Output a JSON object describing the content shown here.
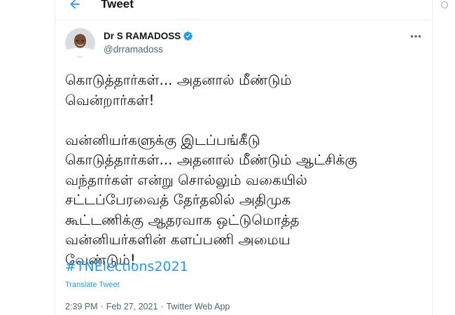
{
  "header": {
    "back_icon": "back-arrow-icon",
    "title": "Tweet",
    "accent_color": "#1d9bf0"
  },
  "tweet": {
    "author": {
      "name": "Dr S RAMADOSS",
      "handle": "@drramadoss",
      "verified": true,
      "verified_icon": "verified-badge-icon"
    },
    "more_icon": "more-horizontal-icon",
    "paragraphs": [
      [
        "கொடுத்தார்கள்... அதனால் மீண்டும்",
        "வென்றார்கள்!"
      ],
      [
        "வன்னியர்களுக்கு இடப்பங்கீடு",
        "கொடுத்தார்கள்... அதனால் மீண்டும் ஆட்சிக்கு",
        "வந்தார்கள் என்று சொல்லும் வகையில்",
        "சட்டப்பேரவைத் தேர்தலில் அதிமுக",
        "கூட்டணிக்கு ஆதரவாக ஒட்டுமொத்த",
        "வன்னியர்களின் களப்பணி அமைய",
        "வேண்டும்!"
      ]
    ],
    "hashtag": "#TNElections2021",
    "translate_label": "Translate Tweet",
    "time": "2:39 PM",
    "separator": "·",
    "date": "Feb 27, 2021",
    "source": "Twitter Web App"
  }
}
